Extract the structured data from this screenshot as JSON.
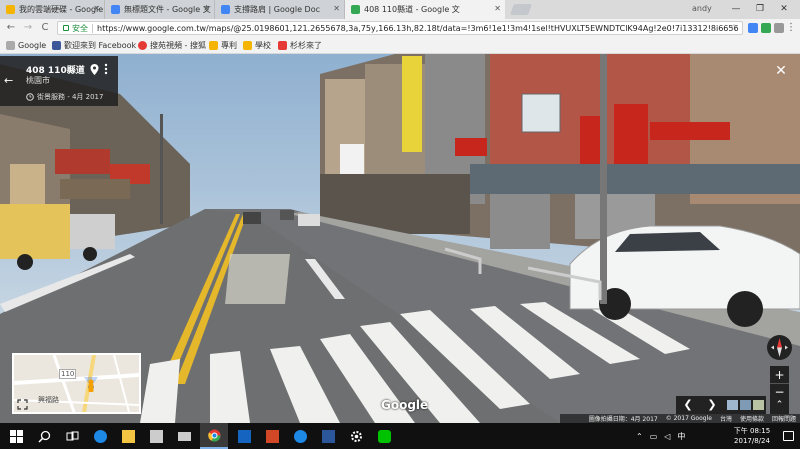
{
  "browser": {
    "tabs": [
      {
        "title": "我的雲端硬碟 - Google",
        "icon_color": "#f4b400",
        "active": false
      },
      {
        "title": "無標題文件 - Google 文",
        "icon_color": "#4285f4",
        "active": false
      },
      {
        "title": "支撐路肩 | Google Doc",
        "icon_color": "#4285f4",
        "active": false
      },
      {
        "title": "408 110縣道 - Google 文",
        "icon_color": "#34a853",
        "active": true
      },
      {
        "title": "",
        "icon_color": "",
        "active": false
      }
    ],
    "user_name": "andy",
    "window_controls": {
      "minimize": "—",
      "maximize": "❐",
      "close": "✕"
    },
    "nav": {
      "back": "←",
      "forward": "→",
      "reload": "C"
    },
    "security_label": "安全",
    "url": "https://www.google.com.tw/maps/@25.0198601,121.2655678,3a,75y,166.13h,82.18t/data=!3m6!1e1!3m4!1sel!tHVUXLT5EWNDTClK94Ag!2e0!7i13312!8i6656",
    "star": "☆",
    "menu": "⋮",
    "bookmarks": [
      {
        "label": "Google",
        "icon_color": "#aaaaaa"
      },
      {
        "label": "歡迎來到 Facebook",
        "icon_color": "#3b5998"
      },
      {
        "label": "搜苑視頻 - 搜狐",
        "icon_color": "#e53935"
      },
      {
        "label": "專利",
        "icon_color": "#f4b400"
      },
      {
        "label": "學校",
        "icon_color": "#f4b400"
      },
      {
        "label": "杉杉來了",
        "icon_color": "#e53935"
      }
    ]
  },
  "streetview": {
    "back_icon": "←",
    "title": "408 110縣道",
    "subtitle": "桃園市",
    "date_text": "街景服務 - 4月 2017",
    "close": "✕",
    "minimap_road_label": "110",
    "minimap_place_label": "興福路",
    "zoom_in": "+",
    "zoom_out": "−",
    "prev": "❮",
    "next": "❯",
    "up": "⌃",
    "google_logo": "Google",
    "footer": {
      "capture": "圖像拍攝日期：4月 2017",
      "copyright": "© 2017 Google",
      "region": "台灣",
      "terms": "使用條款",
      "report": "回報問題"
    }
  },
  "taskbar": {
    "apps": [
      {
        "name": "start",
        "color": "#ffffff"
      },
      {
        "name": "search",
        "color": "#ffffff"
      },
      {
        "name": "task-view",
        "color": "#ffffff"
      },
      {
        "name": "edge",
        "color": "#1e88e5"
      },
      {
        "name": "file-explorer",
        "color": "#f4c542"
      },
      {
        "name": "store",
        "color": "#cccccc"
      },
      {
        "name": "mail",
        "color": "#cccccc"
      },
      {
        "name": "chrome",
        "color": "#e53935"
      },
      {
        "name": "outlook",
        "color": "#1565c0"
      },
      {
        "name": "powerpoint",
        "color": "#d24726"
      },
      {
        "name": "internet-explorer",
        "color": "#1e88e5"
      },
      {
        "name": "word",
        "color": "#2b579a"
      },
      {
        "name": "settings",
        "color": "#ffffff"
      },
      {
        "name": "line",
        "color": "#00c300"
      }
    ],
    "tray": {
      "lang": "中",
      "time_period": "下午 08:15",
      "date": "2017/8/24"
    }
  }
}
